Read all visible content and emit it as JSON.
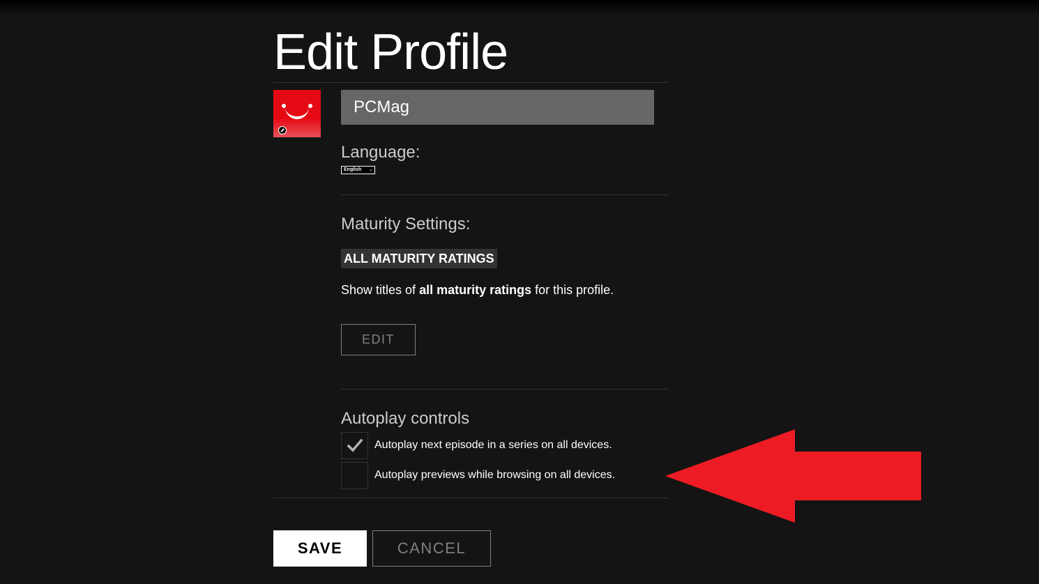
{
  "page": {
    "title": "Edit Profile"
  },
  "profile": {
    "name_value": "PCMag",
    "avatar_color": "#e50914"
  },
  "language": {
    "label": "Language:",
    "selected": "English"
  },
  "maturity": {
    "label": "Maturity Settings:",
    "badge": "ALL MATURITY RATINGS",
    "desc_prefix": "Show titles of ",
    "desc_bold": "all maturity ratings",
    "desc_suffix": " for this profile.",
    "edit_label": "EDIT"
  },
  "autoplay": {
    "label": "Autoplay controls",
    "options": [
      {
        "label": "Autoplay next episode in a series on all devices.",
        "checked": true
      },
      {
        "label": "Autoplay previews while browsing on all devices.",
        "checked": false
      }
    ]
  },
  "actions": {
    "save_label": "SAVE",
    "cancel_label": "CANCEL"
  },
  "annotation": {
    "arrow_color": "#ed1c24",
    "arrow_direction": "left"
  },
  "colors": {
    "background": "#141414",
    "divider": "#333333",
    "input_bg": "#666666",
    "muted": "#808080"
  }
}
